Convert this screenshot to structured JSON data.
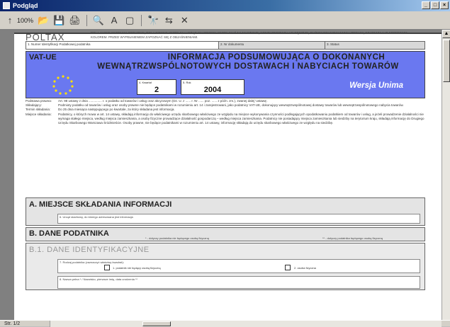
{
  "window": {
    "title": "Podgląd",
    "controls": [
      "_",
      "□",
      "×"
    ]
  },
  "toolbar": {
    "zoom": "100%",
    "icons": [
      "zoom-icon",
      "open-icon",
      "save-icon",
      "print-icon",
      "preview-icon",
      "find-icon",
      "page-icon",
      "binoculars-icon",
      "arrows-icon",
      "close-icon"
    ],
    "glyphs": {
      "zoom": "↑",
      "open": "📂",
      "save": "💾",
      "print": "🖨",
      "preview": "🔍",
      "pdf": "A",
      "page": "▢",
      "find": "🔭",
      "arrows": "⇆",
      "close": "✕"
    }
  },
  "status": {
    "page_indicator": "Str. 1/2"
  },
  "form": {
    "poltax": "POLTAX",
    "poltax_desc": "POLA JASNE WYPEŁNIA PODATNIK, POLA CIEMNE WYPEŁNIA URZĄD SKARBOWY. WYPEŁNIAĆ NA MASZYNIE, KOMPUTEROWO LUB RĘCZNIE, DUŻYMI DRUKOWANYMI LITERAMI, CZARNYM LUB NIEBIESKIM KOLOREM. PRZED WYPEŁNIENIEM ZAPOZNAĆ SIĘ Z OBJAŚNIENIAMI.",
    "hdr": {
      "c1": "1. Numer Identyfikacji Podatkowej podatnika",
      "c2": "2. Nr dokumentu",
      "c3": "3. Status"
    },
    "banner": {
      "vat": "VAT-UE",
      "title_line1": "INFORMACJA PODSUMOWUJĄCA O DOKONANYCH",
      "title_line2": "WEWNĄTRZWSPÓLNOTOWYCH DOSTAWACH I NABYCIACH TOWARÓW",
      "kwartal_label": "4. Kwartał",
      "kwartal_value": "2",
      "rok_label": "5. Rok",
      "rok_value": "2004",
      "wersja": "Wersja Unima"
    },
    "info": [
      {
        "label": "Podstawa prawna:",
        "text": "Art. 98 ustawy z dnia ............... r. o podatku od towarów i usług oraz akcyzowym (Dz. U. z ...... r. Nr ...... poz. ...... z późn. zm.), zwanej dalej 'ustawą'."
      },
      {
        "label": "Składający:",
        "text": "Podmioty podatku od towarów i usług oraz osoby prawne nie będące podatnikami w rozumieniu art. 14 i zarejestrowani, jako podatnicy VAT-UE, dokonujący wewnątrzwspólnotowej dostawy towarów lub wewnątrzwspólnotowego nabycia towarów."
      },
      {
        "label": "Termin składania:",
        "text": "Do 25 dnia miesiąca następującego po kwartale, za który składana jest informacja."
      },
      {
        "label": "Miejsce składania:",
        "text": "Podatnicy, o których mowa w art. 14 ustawy, składają informację do właściwego urzędu skarbowego właściwego ze względu na miejsce wykonywania czynności podlegających opodatkowaniu podatkiem od towarów i usług, a jeżeli prowadzenie działalności nie wymaga stałego miejsca, według miejsca zamieszkania, a osoby fizyczne prowadzące działalność gospodarczą – według miejsca zamieszkania. Podatnicy nie posiadający miejsca zamieszkania lub siedziby na terytorium kraju, składają informację do Drugiego Urzędu Skarbowego Warszawa Śródmieście. Osoby prawne, nie będące podatnikami w rozumieniu art. 14 ustawy, informację składają do urzędu skarbowego właściwego ze względu na siedzibę."
      }
    ],
    "sectionA": {
      "title": "A. MIEJSCE SKŁADANIA INFORMACJI",
      "field": "6. Urząd skarbowy, do którego adresowana jest informacja"
    },
    "sectionB": {
      "title": "B. DANE PODATNIKA",
      "note1": "* - dotyczy podatnika nie będącego osobą fizyczną",
      "note2": "** - dotyczy podatnika będącego osobą fizyczną"
    },
    "sectionB1": {
      "title": "B.1. DANE IDENTYFIKACYJNE",
      "field7": "7. Rodzaj podatnika (zaznaczyć właściwy kwadrat):",
      "opt1": "1. podatnik nie będący osobą fizyczną",
      "opt2": "2. osoba fizyczna",
      "field8": "8. Nazwa pełna * / Nazwisko, pierwsze imię, data urodzenia **"
    }
  }
}
